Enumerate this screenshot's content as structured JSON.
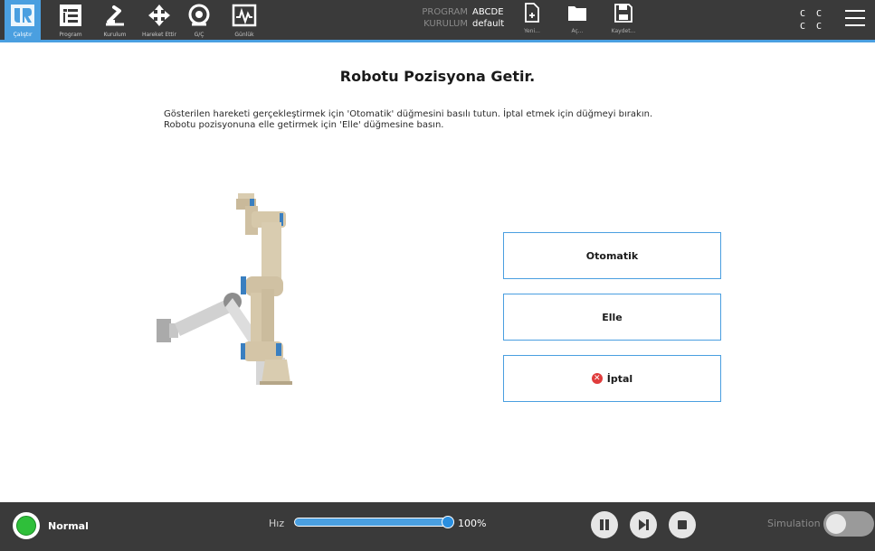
{
  "nav": {
    "items": [
      {
        "label": "Çalıştır",
        "icon": "ur-logo-icon",
        "active": true
      },
      {
        "label": "Program",
        "icon": "program-icon"
      },
      {
        "label": "Kurulum",
        "icon": "installation-icon"
      },
      {
        "label": "Hareket Ettir",
        "icon": "move-icon"
      },
      {
        "label": "G/Ç",
        "icon": "io-icon"
      },
      {
        "label": "Günlük",
        "icon": "log-icon"
      }
    ]
  },
  "program_info": {
    "program_label": "PROGRAM",
    "program_value": "ABCDE",
    "installation_label": "KURULUM",
    "installation_value": "default"
  },
  "file": {
    "new_label": "Yeni...",
    "open_label": "Aç...",
    "save_label": "Kaydet..."
  },
  "top_right": {
    "cc_line1": "C C",
    "cc_line2": "C C"
  },
  "main": {
    "title": "Robotu Pozisyona Getir.",
    "instruction_line1": "Gösterilen hareketi gerçekleştirmek için 'Otomatik' düğmesini basılı tutun. İptal etmek için düğmeyi bırakın.",
    "instruction_line2": "Robotu pozisyonuna elle getirmek için 'Elle' düğmesine basın.",
    "auto_label": "Otomatik",
    "manual_label": "Elle",
    "cancel_label": "İptal"
  },
  "bottom": {
    "status": "Normal",
    "speed_label": "Hız",
    "speed_value": "100%",
    "speed_fraction": 1.0,
    "simulation_label": "Simulation",
    "simulation_on": false
  },
  "colors": {
    "accent": "#4a9fe0",
    "bar_bg": "#3a3a3a",
    "status_ok": "#2fbf3a",
    "cancel_red": "#e03c3c"
  }
}
